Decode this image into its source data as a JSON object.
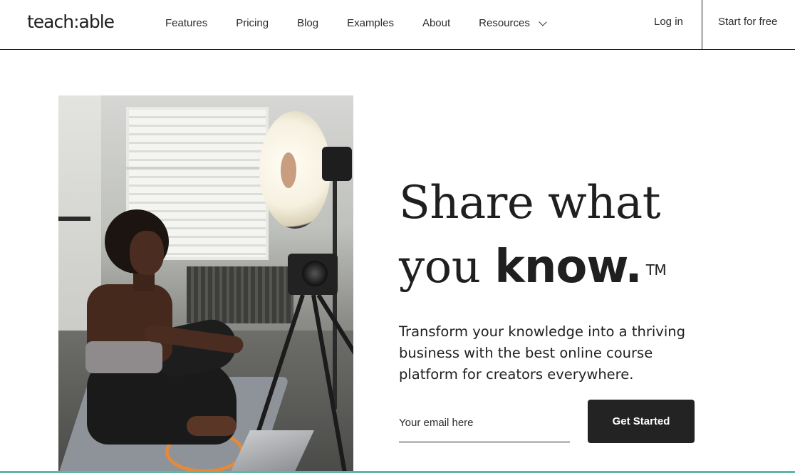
{
  "header": {
    "logo": "teach:able",
    "nav": [
      "Features",
      "Pricing",
      "Blog",
      "Examples",
      "About",
      "Resources"
    ],
    "login": "Log in",
    "start": "Start for free"
  },
  "hero": {
    "headline_line1": "Share what",
    "headline_line2_a": "you ",
    "headline_line2_b": "know.",
    "trademark": "TM",
    "subtext": "Transform your knowledge into a thriving business with the best online course platform for creators everywhere.",
    "email_placeholder": "Your email here",
    "cta_label": "Get Started",
    "accent_color": "#5fb6ab",
    "button_color": "#232323"
  },
  "icons": {
    "resources_dropdown": "chevron-down-icon"
  }
}
